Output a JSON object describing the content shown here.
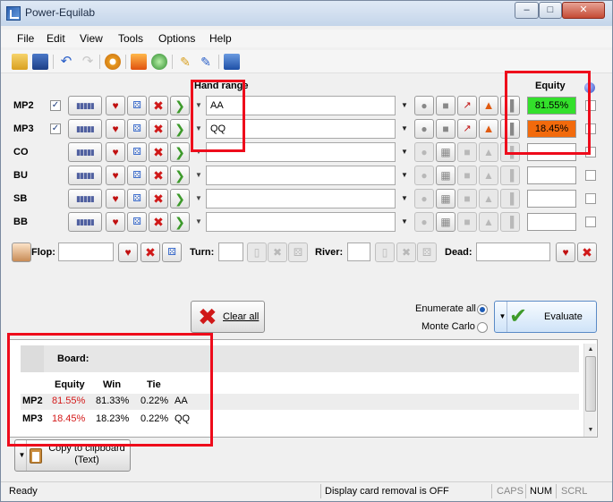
{
  "window": {
    "title": "Power-Equilab",
    "min_glyph": "–",
    "max_glyph": "□",
    "close_glyph": "✕"
  },
  "menu": [
    "File",
    "Edit",
    "View",
    "Tools",
    "Options",
    "Help"
  ],
  "headers": {
    "hand_range": "Hand range",
    "equity": "Equity"
  },
  "players": [
    {
      "name": "MP2",
      "checked": true,
      "checkmark": "✓",
      "range": "AA",
      "equity": "81.55%",
      "equity_color": "#33e02b"
    },
    {
      "name": "MP3",
      "checked": true,
      "checkmark": "✓",
      "range": "QQ",
      "equity": "18.45%",
      "equity_color": "#f26a0c"
    },
    {
      "name": "CO",
      "checked": false,
      "range": "",
      "equity": ""
    },
    {
      "name": "BU",
      "checked": false,
      "range": "",
      "equity": ""
    },
    {
      "name": "SB",
      "checked": false,
      "range": "",
      "equity": ""
    },
    {
      "name": "BB",
      "checked": false,
      "range": "",
      "equity": ""
    }
  ],
  "board": {
    "flop": "Flop:",
    "turn": "Turn:",
    "river": "River:",
    "dead": "Dead:"
  },
  "actions": {
    "clear_all": "Clear all",
    "enumerate_all": "Enumerate all",
    "monte_carlo": "Monte Carlo",
    "evaluate": "Evaluate",
    "copy_line1": "Copy to clipboard",
    "copy_line2": "(Text)"
  },
  "results": {
    "board_label": "Board:",
    "columns": [
      "Equity",
      "Win",
      "Tie"
    ],
    "rows": [
      {
        "name": "MP2",
        "equity": "81.55%",
        "win": "81.33%",
        "tie": "0.22%",
        "hand": "AA"
      },
      {
        "name": "MP3",
        "equity": "18.45%",
        "win": "18.23%",
        "tie": "0.22%",
        "hand": "QQ"
      }
    ]
  },
  "status": {
    "ready": "Ready",
    "display": "Display card removal is OFF",
    "caps": "CAPS",
    "num": "NUM",
    "scrl": "SCRL"
  },
  "colors": {
    "highlight_frame": "#ee0b1b",
    "equity_red": "#d41a1a"
  }
}
